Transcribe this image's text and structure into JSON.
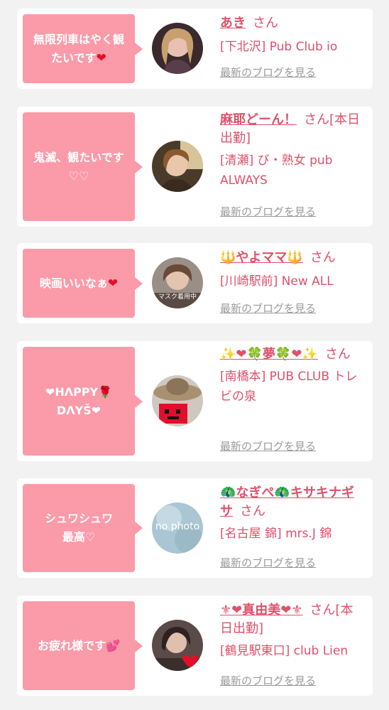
{
  "cards": [
    {
      "comment": "無限列車はやく観たいです",
      "comment_emoji": "❤",
      "name": "あき",
      "suffix": "さん",
      "shop": "[下北沢] Pub Club io",
      "blog_link": "最新のブログを見る"
    },
    {
      "comment": "鬼滅、観たいです♡♡",
      "comment_emoji": "",
      "name": "麻耶どーん！",
      "suffix": "さん[本日出勤]",
      "shop": "[清瀬] び・熟女 pub ALWAYS",
      "blog_link": "最新のブログを見る"
    },
    {
      "comment": "映画いいなぁ",
      "comment_emoji": "❤",
      "name": "🔱やよママ🔱",
      "suffix": "さん",
      "shop": "[川崎駅前] New ALL",
      "blog_link": "最新のブログを見る"
    },
    {
      "comment": "❤HΛPPY🌹DΛYŠ❤",
      "comment_emoji": "",
      "name": "✨❤🍀夢🍀❤✨",
      "suffix": "さん",
      "shop": "[南橋本] PUB CLUB トレビの泉",
      "blog_link": "最新のブログを見る"
    },
    {
      "comment": "シュワシュワ最高♡",
      "comment_emoji": "",
      "name": "🦚なぎぺ🦚キサキナギサ",
      "suffix": "さん",
      "shop": "[名古屋 錦] mrs.J 錦",
      "blog_link": "最新のブログを見る"
    },
    {
      "comment": "お疲れ様です",
      "comment_emoji": "💕",
      "name": "⚜❤真由美❤⚜",
      "suffix": "さん[本日出勤]",
      "shop": "[鶴見駅東口] club Lien",
      "blog_link": "最新のブログを見る"
    }
  ],
  "avatars": [
    {
      "icon": "woman-portrait-icon"
    },
    {
      "icon": "woman-portrait-icon"
    },
    {
      "icon": "woman-portrait-icon",
      "caption": "マスク着用中"
    },
    {
      "icon": "hat-pixel-face-icon"
    },
    {
      "icon": "no-photo-icon",
      "caption": "no photo"
    },
    {
      "icon": "woman-portrait-heart-icon"
    }
  ],
  "colors": {
    "bubble": "#fb9aa8",
    "accent": "#e0506a",
    "link": "#9a9a9a",
    "background": "#f2f2f2"
  }
}
